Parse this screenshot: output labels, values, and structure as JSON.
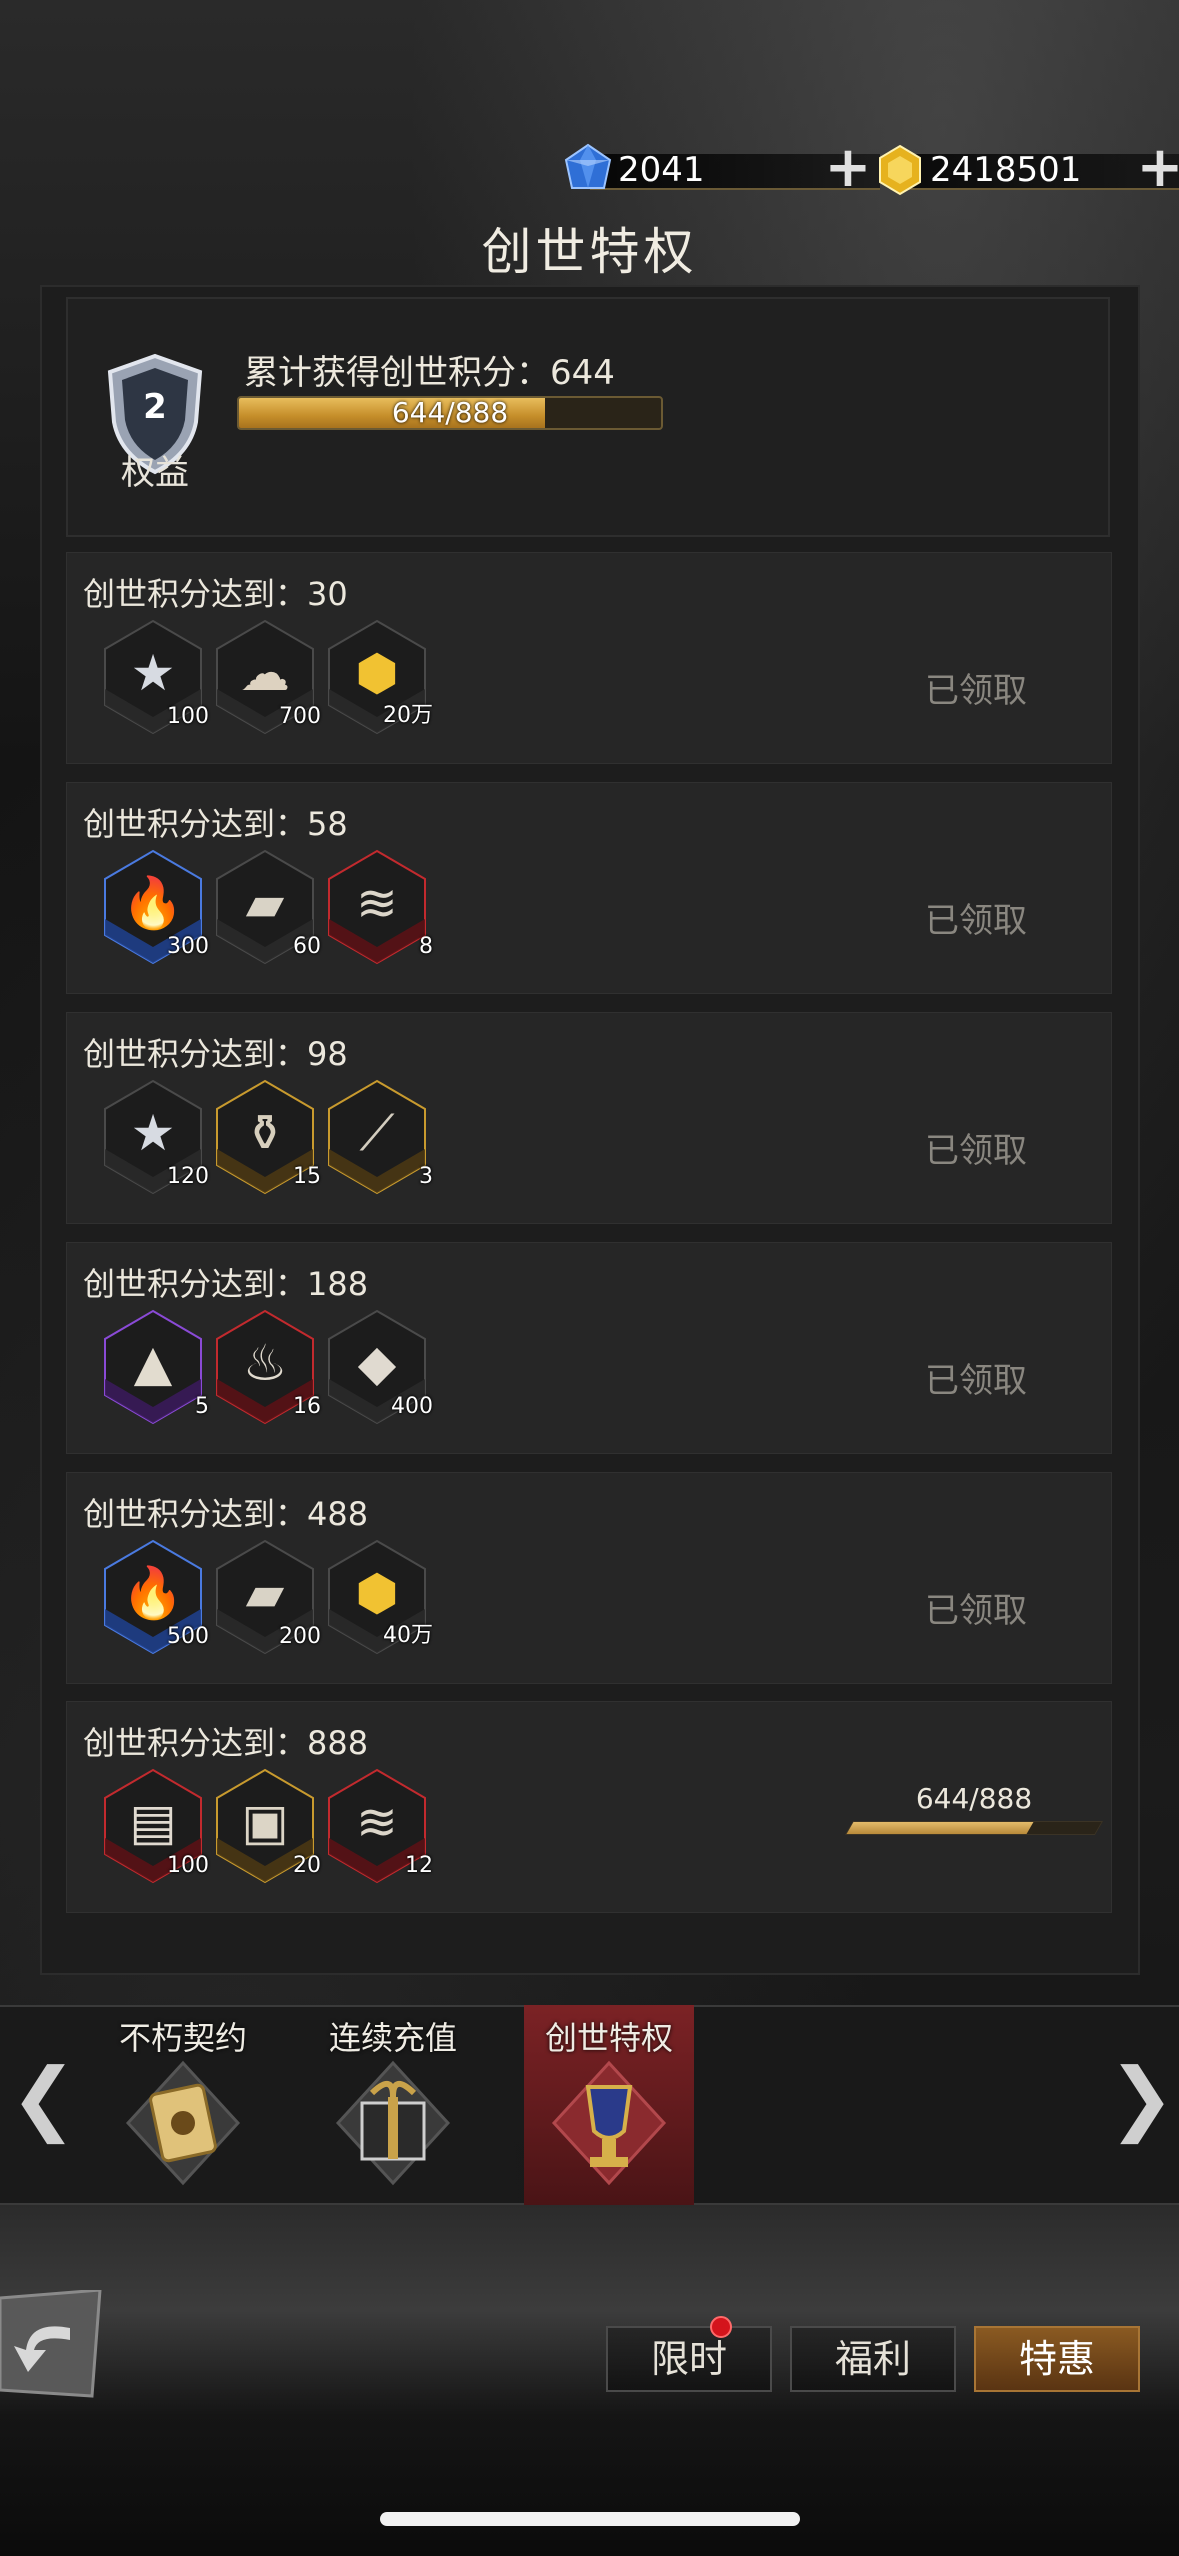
{
  "currency": {
    "gems": {
      "value": "2041",
      "icon": "blue-gem-icon",
      "color": "#3a7be0"
    },
    "gold": {
      "value": "2418501",
      "icon": "gold-coin-icon",
      "color": "#e6b21e"
    }
  },
  "page": {
    "title": "创世特权"
  },
  "header": {
    "badge_level": "2",
    "badge_label": "权益",
    "title": "累计获得创世积分：644",
    "progress_text": "644/888",
    "progress": 0.725
  },
  "milestones": [
    {
      "title": "创世积分达到：30",
      "status": "已领取",
      "items": [
        {
          "icon": "silver-star-coin-icon",
          "qty": "100",
          "rarity": "gray"
        },
        {
          "icon": "bone-fragment-icon",
          "qty": "700",
          "rarity": "gray"
        },
        {
          "icon": "gold-gem-icon",
          "qty": "20万",
          "rarity": "gray"
        }
      ]
    },
    {
      "title": "创世积分达到：58",
      "status": "已领取",
      "items": [
        {
          "icon": "torch-icon",
          "qty": "300",
          "rarity": "blue"
        },
        {
          "icon": "scroll-fragment-icon",
          "qty": "60",
          "rarity": "gray"
        },
        {
          "icon": "scroll-icon",
          "qty": "8",
          "rarity": "red"
        }
      ]
    },
    {
      "title": "创世积分达到：98",
      "status": "已领取",
      "items": [
        {
          "icon": "silver-star-coin-icon",
          "qty": "120",
          "rarity": "gray"
        },
        {
          "icon": "potion-jar-icon",
          "qty": "15",
          "rarity": "gold"
        },
        {
          "icon": "crystal-wand-icon",
          "qty": "3",
          "rarity": "gold"
        }
      ]
    },
    {
      "title": "创世积分达到：188",
      "status": "已领取",
      "items": [
        {
          "icon": "ore-pile-icon",
          "qty": "5",
          "rarity": "purple"
        },
        {
          "icon": "flame-icon",
          "qty": "16",
          "rarity": "red"
        },
        {
          "icon": "crystal-shard-icon",
          "qty": "400",
          "rarity": "gray"
        }
      ]
    },
    {
      "title": "创世积分达到：488",
      "status": "已领取",
      "items": [
        {
          "icon": "torch-icon",
          "qty": "500",
          "rarity": "blue"
        },
        {
          "icon": "scroll-fragment-icon",
          "qty": "200",
          "rarity": "gray"
        },
        {
          "icon": "gold-gem-icon",
          "qty": "40万",
          "rarity": "gray"
        }
      ]
    },
    {
      "title": "创世积分达到：888",
      "status": "",
      "progress_text": "644/888",
      "progress": 0.725,
      "items": [
        {
          "icon": "stone-tablet-icon",
          "qty": "100",
          "rarity": "red"
        },
        {
          "icon": "treasure-chest-icon",
          "qty": "20",
          "rarity": "gold"
        },
        {
          "icon": "scroll-icon",
          "qty": "12",
          "rarity": "red"
        }
      ]
    }
  ],
  "carousel": {
    "tabs": [
      {
        "label": "不朽契约",
        "icon": "contract-scroll-icon",
        "active": false
      },
      {
        "label": "连续充值",
        "icon": "gift-box-icon",
        "active": false
      },
      {
        "label": "创世特权",
        "icon": "trophy-icon",
        "active": true
      }
    ],
    "left_arrow": "❮",
    "right_arrow": "❯"
  },
  "nav": {
    "buttons": [
      {
        "label": "限时",
        "active": false,
        "badge": true
      },
      {
        "label": "福利",
        "active": false,
        "badge": false
      },
      {
        "label": "特惠",
        "active": true,
        "badge": false
      }
    ]
  },
  "colors": {
    "accent_gold": "#c58e2a",
    "active_tab": "#7b2225"
  }
}
